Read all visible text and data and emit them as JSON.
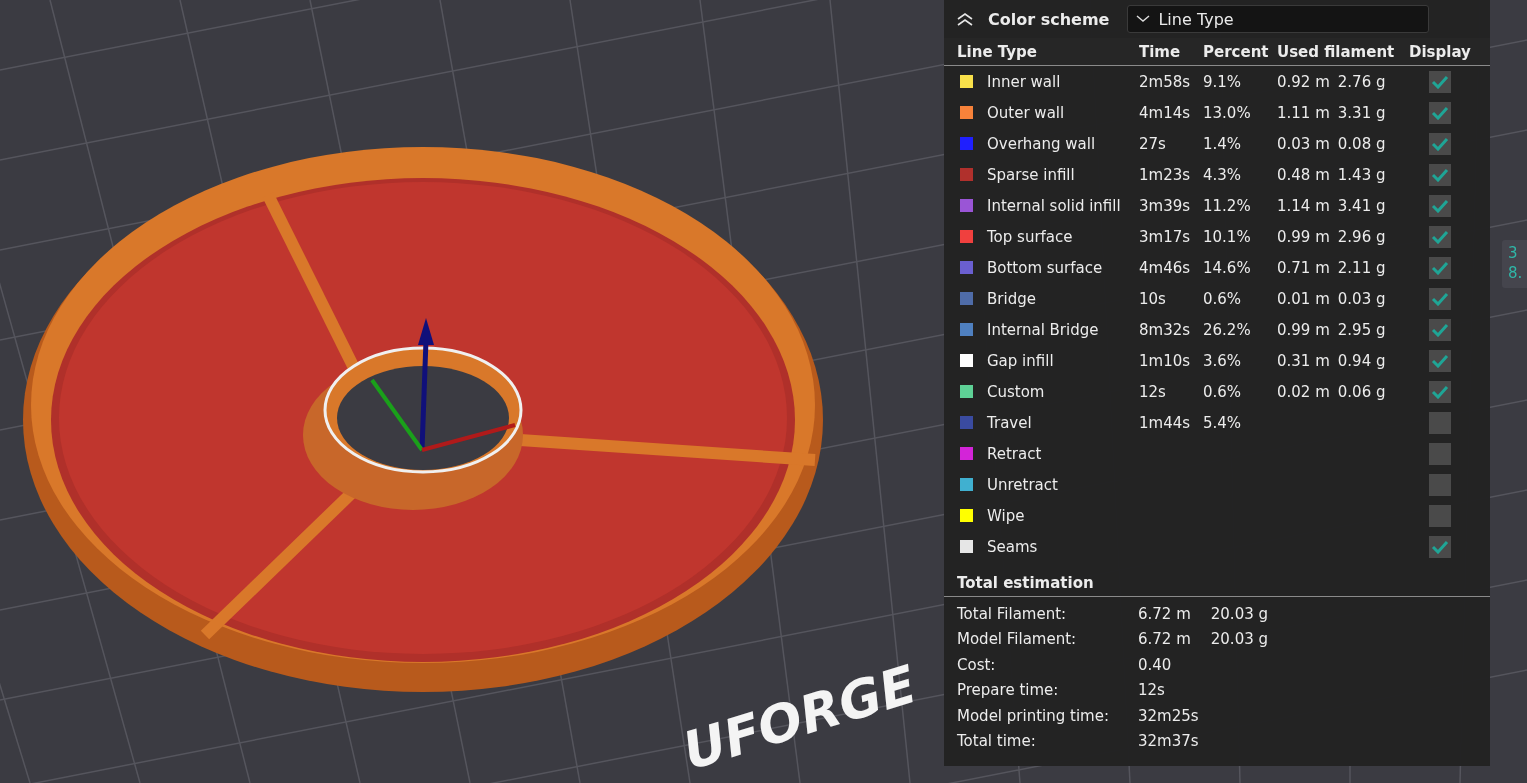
{
  "viewport": {
    "bed_logo": "UFORGE",
    "side_tag": [
      "3",
      "8."
    ]
  },
  "color_scheme": {
    "label": "Color scheme",
    "value": "Line Type"
  },
  "table": {
    "columns": [
      "Line Type",
      "Time",
      "Percent",
      "Used filament",
      "Display"
    ],
    "rows": [
      {
        "name": "Inner wall",
        "color": "#f8e04a",
        "time": "2m58s",
        "percent": "9.1%",
        "length": "0.92 m",
        "weight": "2.76 g",
        "displayed": true
      },
      {
        "name": "Outer wall",
        "color": "#f7823a",
        "time": "4m14s",
        "percent": "13.0%",
        "length": "1.11 m",
        "weight": "3.31 g",
        "displayed": true
      },
      {
        "name": "Overhang wall",
        "color": "#1f1fff",
        "time": "27s",
        "percent": "1.4%",
        "length": "0.03 m",
        "weight": "0.08 g",
        "displayed": true
      },
      {
        "name": "Sparse infill",
        "color": "#b0302c",
        "time": "1m23s",
        "percent": "4.3%",
        "length": "0.48 m",
        "weight": "1.43 g",
        "displayed": true
      },
      {
        "name": "Internal solid infill",
        "color": "#9a55d6",
        "time": "3m39s",
        "percent": "11.2%",
        "length": "1.14 m",
        "weight": "3.41 g",
        "displayed": true
      },
      {
        "name": "Top surface",
        "color": "#f0403e",
        "time": "3m17s",
        "percent": "10.1%",
        "length": "0.99 m",
        "weight": "2.96 g",
        "displayed": true
      },
      {
        "name": "Bottom surface",
        "color": "#6a5fd0",
        "time": "4m46s",
        "percent": "14.6%",
        "length": "0.71 m",
        "weight": "2.11 g",
        "displayed": true
      },
      {
        "name": "Bridge",
        "color": "#4f6ca8",
        "time": "10s",
        "percent": "0.6%",
        "length": "0.01 m",
        "weight": "0.03 g",
        "displayed": true
      },
      {
        "name": "Internal Bridge",
        "color": "#4f80c0",
        "time": "8m32s",
        "percent": "26.2%",
        "length": "0.99 m",
        "weight": "2.95 g",
        "displayed": true
      },
      {
        "name": "Gap infill",
        "color": "#ffffff",
        "time": "1m10s",
        "percent": "3.6%",
        "length": "0.31 m",
        "weight": "0.94 g",
        "displayed": true
      },
      {
        "name": "Custom",
        "color": "#5ed196",
        "time": "12s",
        "percent": "0.6%",
        "length": "0.02 m",
        "weight": "0.06 g",
        "displayed": true
      },
      {
        "name": "Travel",
        "color": "#3a4ba0",
        "time": "1m44s",
        "percent": "5.4%",
        "displayed": false
      },
      {
        "name": "Retract",
        "color": "#d324d8",
        "displayed": false
      },
      {
        "name": "Unretract",
        "color": "#40b0d0",
        "displayed": false
      },
      {
        "name": "Wipe",
        "color": "#ffff00",
        "displayed": false
      },
      {
        "name": "Seams",
        "color": "#e6e6e6",
        "displayed": true
      }
    ]
  },
  "total_estimation": {
    "title": "Total estimation",
    "rows": [
      {
        "label": "Total Filament:",
        "values": [
          "6.72 m",
          "20.03 g"
        ]
      },
      {
        "label": "Model Filament:",
        "values": [
          "6.72 m",
          "20.03 g"
        ]
      },
      {
        "label": "Cost:",
        "values": [
          "0.40"
        ]
      },
      {
        "label": "Prepare time:",
        "values": [
          "12s"
        ]
      },
      {
        "label": "Model printing time:",
        "values": [
          "32m25s"
        ]
      },
      {
        "label": "Total time:",
        "values": [
          "32m37s"
        ]
      }
    ]
  }
}
